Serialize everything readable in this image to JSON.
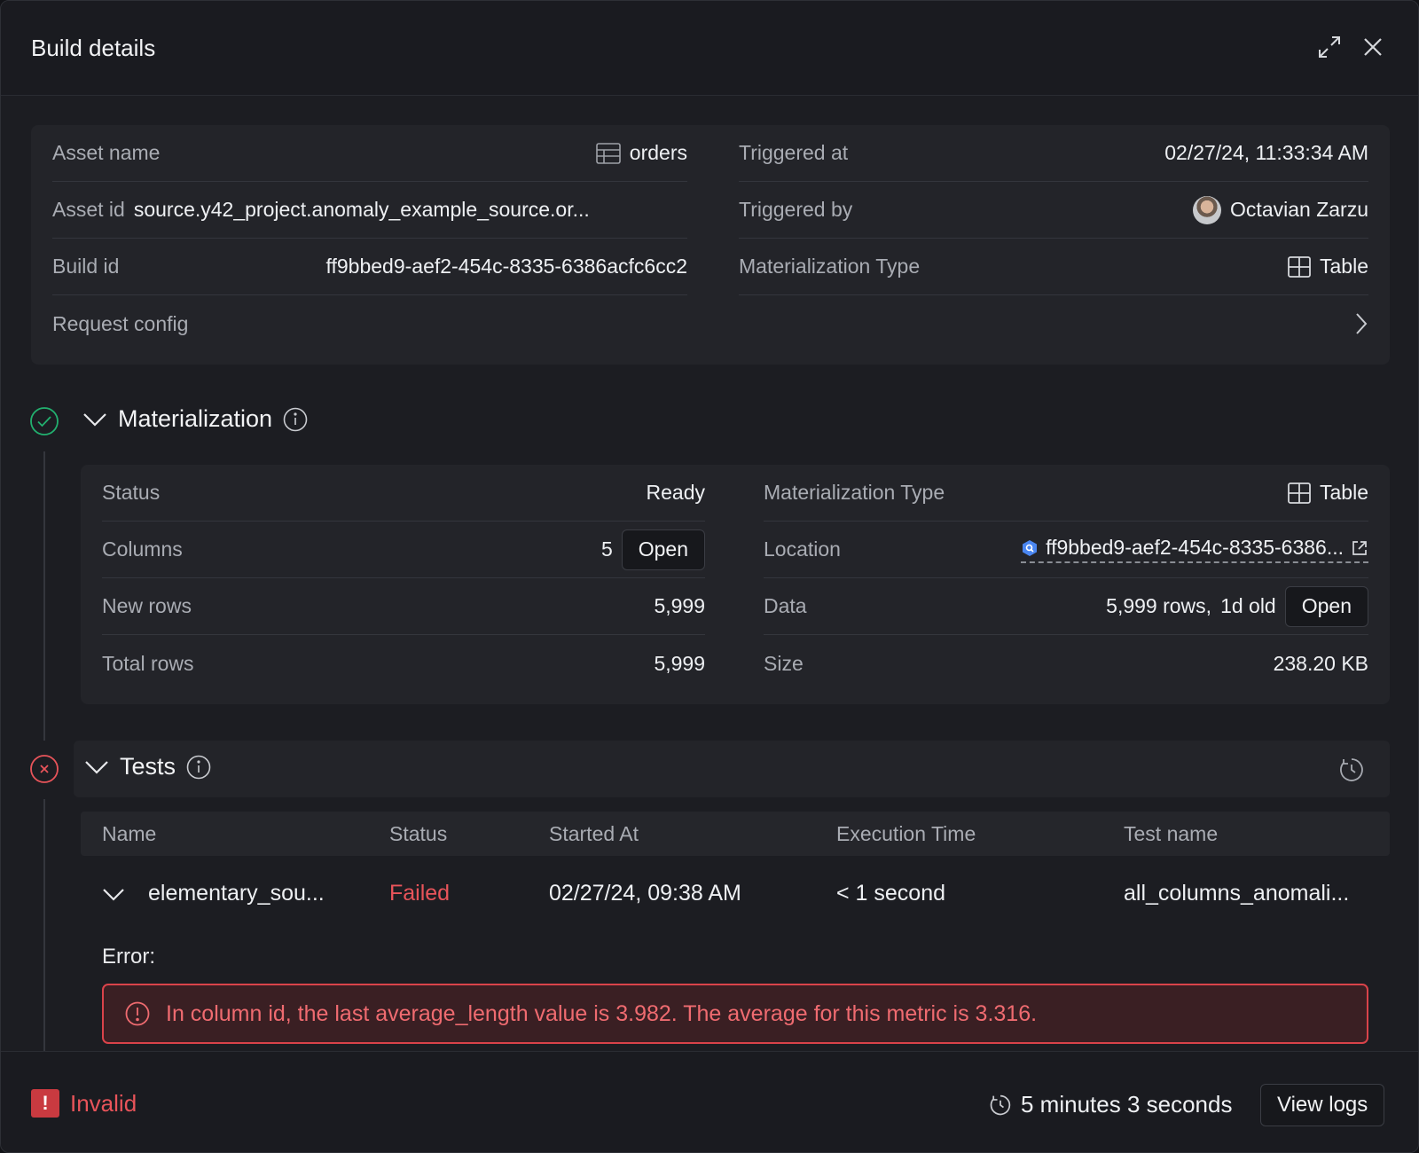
{
  "header": {
    "title": "Build details",
    "expand_icon": "expand-icon",
    "close_icon": "close-icon"
  },
  "info": {
    "asset_name_label": "Asset name",
    "asset_name_value": "orders",
    "asset_id_label": "Asset id",
    "asset_id_value": "source.y42_project.anomaly_example_source.or...",
    "build_id_label": "Build id",
    "build_id_value": "ff9bbed9-aef2-454c-8335-6386acfc6cc2",
    "request_config_label": "Request config",
    "triggered_at_label": "Triggered at",
    "triggered_at_value": "02/27/24, 11:33:34 AM",
    "triggered_by_label": "Triggered by",
    "triggered_by_value": "Octavian Zarzu",
    "mat_type_label": "Materialization Type",
    "mat_type_value": "Table"
  },
  "materialization": {
    "title": "Materialization",
    "status_label": "Status",
    "status_value": "Ready",
    "columns_label": "Columns",
    "columns_value": "5",
    "columns_open": "Open",
    "new_rows_label": "New rows",
    "new_rows_value": "5,999",
    "total_rows_label": "Total rows",
    "total_rows_value": "5,999",
    "type_label": "Materialization Type",
    "type_value": "Table",
    "location_label": "Location",
    "location_value": "ff9bbed9-aef2-454c-8335-6386...",
    "data_label": "Data",
    "data_rows": "5,999 rows,",
    "data_age": "1d old",
    "data_open": "Open",
    "size_label": "Size",
    "size_value": "238.20 KB"
  },
  "tests": {
    "title": "Tests",
    "columns": [
      "Name",
      "Status",
      "Started At",
      "Execution Time",
      "Test name"
    ],
    "row": {
      "name": "elementary_sou...",
      "status": "Failed",
      "started_at": "02/27/24, 09:38 AM",
      "execution_time": "< 1 second",
      "test_name": "all_columns_anomali..."
    },
    "error_label": "Error:",
    "error_message": "In column id, the last average_length value is 3.982. The average for this metric is 3.316."
  },
  "footer": {
    "status": "Invalid",
    "duration": "5 minutes 3 seconds",
    "view_logs": "View logs"
  },
  "colors": {
    "ready": "#22b06f",
    "failed": "#e8545a",
    "background": "#1c1d22"
  }
}
